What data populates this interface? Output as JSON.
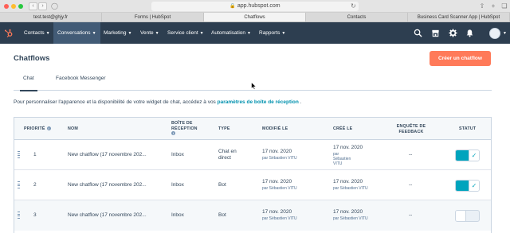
{
  "browser": {
    "url": "app.hubspot.com",
    "tabs": [
      {
        "label": "test.test@ghjy.fr",
        "active": false
      },
      {
        "label": "Forms | HubSpot",
        "active": false
      },
      {
        "label": "Chatflows",
        "active": true
      },
      {
        "label": "Contacts",
        "active": false
      },
      {
        "label": "Business Card Scanner App | HubSpot",
        "active": false
      }
    ]
  },
  "topnav": {
    "items": [
      {
        "label": "Contacts",
        "active": false
      },
      {
        "label": "Conversations",
        "active": true
      },
      {
        "label": "Marketing",
        "active": false
      },
      {
        "label": "Vente",
        "active": false
      },
      {
        "label": "Service client",
        "active": false
      },
      {
        "label": "Automatisation",
        "active": false
      },
      {
        "label": "Rapports",
        "active": false
      }
    ]
  },
  "page": {
    "title": "Chatflows",
    "create_button": "Créer un chatflow",
    "subtabs": [
      "Chat",
      "Facebook Messenger"
    ],
    "description_prefix": "Pour personnaliser l'apparence et la disponibilité de votre widget de chat, accédez à vos",
    "description_link": "paramètres de boîte de réception",
    "description_suffix": "."
  },
  "table": {
    "headers": {
      "priority": "PRIORITÉ",
      "name": "NOM",
      "inbox_1": "BOÎTE DE",
      "inbox_2": "RÉCEPTION",
      "type": "TYPE",
      "modified": "MODIFIÉ LE",
      "created": "CRÉÉ LE",
      "survey_1": "ENQUÊTE DE",
      "survey_2": "FEEDBACK",
      "status": "STATUT"
    },
    "rows": [
      {
        "priority": "1",
        "name": "New chatflow (17 novembre 202...",
        "inbox": "Inbox",
        "type_1": "Chat en",
        "type_2": "direct",
        "modified_date": "17 nov. 2020",
        "modified_by": "par Sébastien VITU",
        "created_date": "17 nov. 2020",
        "created_by_1": "par",
        "created_by_2": "Sébastien",
        "created_by_3": "VITU",
        "survey": "--",
        "status_on": true
      },
      {
        "priority": "2",
        "name": "New chatflow (17 novembre 202...",
        "inbox": "Inbox",
        "type_1": "Bot",
        "type_2": "",
        "modified_date": "17 nov. 2020",
        "modified_by": "par Sébastien VITU",
        "created_date": "17 nov. 2020",
        "created_by_1": "par Sébastien VITU",
        "created_by_2": "",
        "created_by_3": "",
        "survey": "--",
        "status_on": true
      },
      {
        "priority": "3",
        "name": "New chatflow (17 novembre 202...",
        "inbox": "Inbox",
        "type_1": "Bot",
        "type_2": "",
        "modified_date": "17 nov. 2020",
        "modified_by": "par Sébastien VITU",
        "created_date": "17 nov. 2020",
        "created_by_1": "par Sébastien VITU",
        "created_by_2": "",
        "created_by_3": "",
        "survey": "--",
        "status_on": false
      }
    ]
  },
  "colors": {
    "nav_bg": "#2d3e50",
    "nav_active": "#425b76",
    "accent_orange": "#ff7a59",
    "toggle_on": "#00a4bd",
    "link": "#0091ae"
  }
}
